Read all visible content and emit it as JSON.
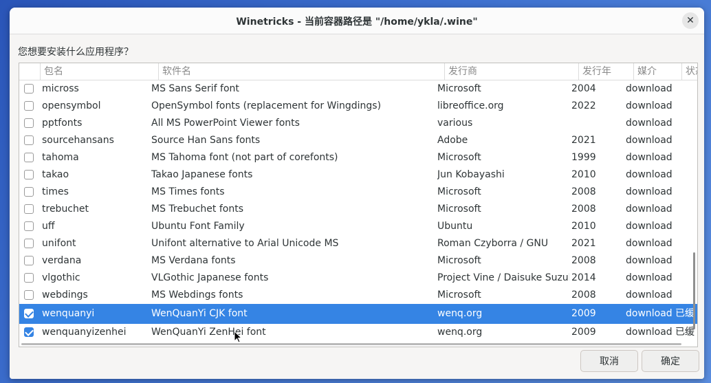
{
  "window": {
    "title": "Winetricks - 当前容器路径是 \"/home/ykla/.wine\"",
    "close_glyph": "✕"
  },
  "prompt": "您想要安装什么应用程序？",
  "table": {
    "columns": [
      "",
      "包名",
      "软件名",
      "发行商",
      "发行年",
      "媒介",
      "状态"
    ],
    "rows": [
      {
        "checked": false,
        "selected": false,
        "name": "micross",
        "title": "MS Sans Serif font",
        "publisher": "Microsoft",
        "year": "2004",
        "media": "download",
        "status": ""
      },
      {
        "checked": false,
        "selected": false,
        "name": "opensymbol",
        "title": "OpenSymbol fonts (replacement for Wingdings)",
        "publisher": "libreoffice.org",
        "year": "2022",
        "media": "download",
        "status": ""
      },
      {
        "checked": false,
        "selected": false,
        "name": "pptfonts",
        "title": "All MS PowerPoint Viewer fonts",
        "publisher": "various",
        "year": "",
        "media": "download",
        "status": ""
      },
      {
        "checked": false,
        "selected": false,
        "name": "sourcehansans",
        "title": "Source Han Sans fonts",
        "publisher": "Adobe",
        "year": "2021",
        "media": "download",
        "status": ""
      },
      {
        "checked": false,
        "selected": false,
        "name": "tahoma",
        "title": "MS Tahoma font (not part of corefonts)",
        "publisher": "Microsoft",
        "year": "1999",
        "media": "download",
        "status": ""
      },
      {
        "checked": false,
        "selected": false,
        "name": "takao",
        "title": "Takao Japanese fonts",
        "publisher": "Jun Kobayashi",
        "year": "2010",
        "media": "download",
        "status": ""
      },
      {
        "checked": false,
        "selected": false,
        "name": "times",
        "title": "MS Times fonts",
        "publisher": "Microsoft",
        "year": "2008",
        "media": "download",
        "status": ""
      },
      {
        "checked": false,
        "selected": false,
        "name": "trebuchet",
        "title": "MS Trebuchet fonts",
        "publisher": "Microsoft",
        "year": "2008",
        "media": "download",
        "status": ""
      },
      {
        "checked": false,
        "selected": false,
        "name": "uff",
        "title": "Ubuntu Font Family",
        "publisher": "Ubuntu",
        "year": "2010",
        "media": "download",
        "status": ""
      },
      {
        "checked": false,
        "selected": false,
        "name": "unifont",
        "title": "Unifont alternative to Arial Unicode MS",
        "publisher": "Roman Czyborra / GNU",
        "year": "2021",
        "media": "download",
        "status": ""
      },
      {
        "checked": false,
        "selected": false,
        "name": "verdana",
        "title": "MS Verdana fonts",
        "publisher": "Microsoft",
        "year": "2008",
        "media": "download",
        "status": ""
      },
      {
        "checked": false,
        "selected": false,
        "name": "vlgothic",
        "title": "VLGothic Japanese fonts",
        "publisher": "Project Vine / Daisuke Suzuki",
        "year": "2014",
        "media": "download",
        "status": ""
      },
      {
        "checked": false,
        "selected": false,
        "name": "webdings",
        "title": "MS Webdings fonts",
        "publisher": "Microsoft",
        "year": "2008",
        "media": "download",
        "status": ""
      },
      {
        "checked": true,
        "selected": true,
        "name": "wenquanyi",
        "title": "WenQuanYi CJK font",
        "publisher": "wenq.org",
        "year": "2009",
        "media": "download",
        "status": "已缓"
      },
      {
        "checked": true,
        "selected": false,
        "name": "wenquanyizenhei",
        "title": "WenQuanYi ZenHei font",
        "publisher": "wenq.org",
        "year": "2009",
        "media": "download",
        "status": "已缓"
      }
    ]
  },
  "buttons": {
    "cancel": "取消",
    "ok": "确定"
  },
  "colors": {
    "selection": "#3584e4",
    "desktop": "#3f72d0"
  }
}
